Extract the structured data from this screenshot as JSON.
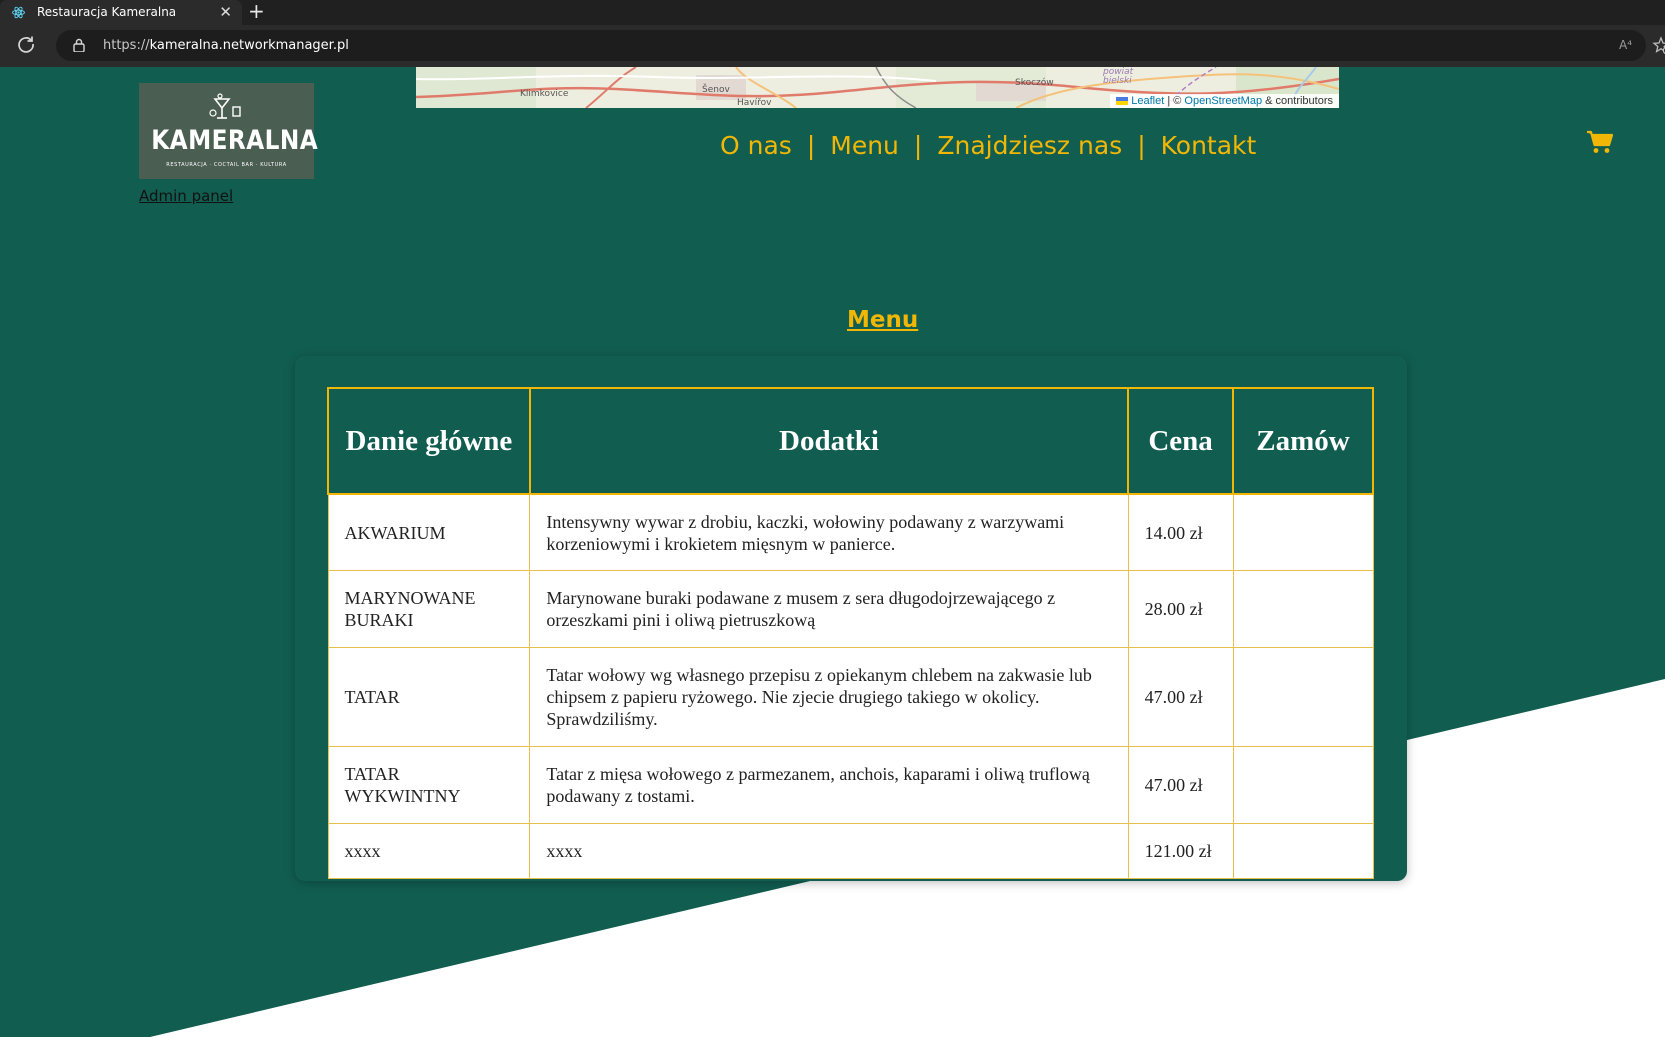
{
  "browser": {
    "tab_title": "Restauracja Kameralna",
    "tab_close": "✕",
    "new_tab": "+",
    "url_scheme": "https://",
    "url_host": "kameralna.networkmanager.pl",
    "read_aloud": "A⁴"
  },
  "map": {
    "places": [
      "Klimkovice",
      "Šenov",
      "Havířov",
      "Skoczów",
      "powiat bielski"
    ],
    "attribution": {
      "leaflet": "Leaflet",
      "separator": " | © ",
      "osm": "OpenStreetMap",
      "contributors": " & contributors"
    }
  },
  "logo": {
    "name": "KAMERALNA",
    "tagline": "RESTAURACJA · COCTAIL BAR · KULTURA"
  },
  "admin_link": "Admin panel",
  "nav": {
    "items": [
      "O nas",
      "Menu",
      "Znajdziesz nas",
      "Kontakt"
    ],
    "separator": "|"
  },
  "section_title": "Menu",
  "table": {
    "headers": [
      "Danie główne",
      "Dodatki",
      "Cena",
      "Zamów"
    ],
    "rows": [
      {
        "dish": "AKWARIUM",
        "sides": "Intensywny wywar z drobiu, kaczki, wołowiny podawany z warzywami korzeniowymi i krokietem mięsnym w panierce.",
        "price": "14.00 zł",
        "order": ""
      },
      {
        "dish": "MARYNOWANE BURAKI",
        "sides": "Marynowane buraki podawane z musem z sera długodojrzewającego z orzeszkami pini i oliwą pietruszkową",
        "price": "28.00 zł",
        "order": ""
      },
      {
        "dish": "TATAR",
        "sides": "Tatar wołowy wg własnego przepisu z opiekanym chlebem na zakwasie lub chipsem z papieru ryżowego. Nie zjecie drugiego takiego w okolicy. Sprawdziliśmy.",
        "price": "47.00 zł",
        "order": ""
      },
      {
        "dish": "TATAR WYKWINTNY",
        "sides": "Tatar z mięsa wołowego z parmezanem, anchois, kaparami i oliwą truflową podawany z tostami.",
        "price": "47.00 zł",
        "order": ""
      },
      {
        "dish": "xxxx",
        "sides": "xxxx",
        "price": "121.00 zł",
        "order": ""
      }
    ]
  },
  "colors": {
    "brand_green": "#115d50",
    "accent_yellow": "#f2b705",
    "logo_bg": "#4b5e52"
  },
  "icons": {
    "cart": "shopping-cart-icon",
    "favicon": "react-atom-icon",
    "reload": "reload-icon",
    "lock": "lock-icon"
  }
}
